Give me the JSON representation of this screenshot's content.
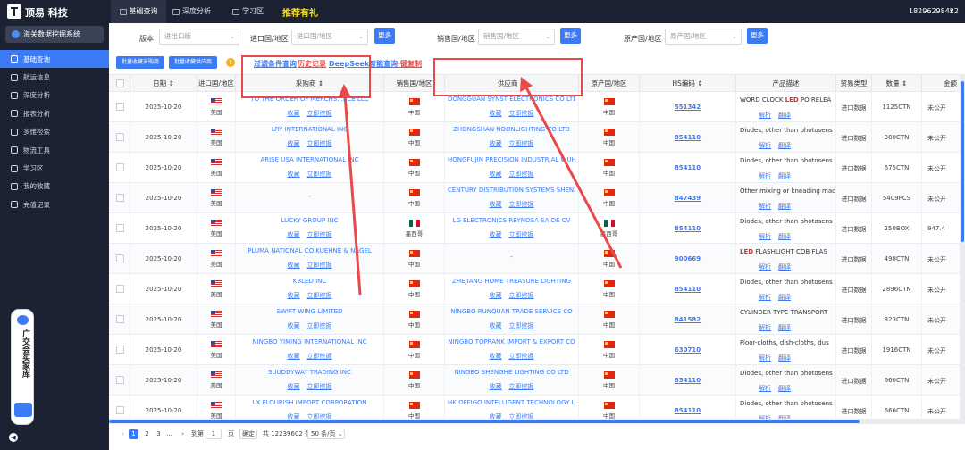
{
  "brand": "顶易 科技",
  "nav": {
    "tabs": [
      "基础查询",
      "深度分析",
      "学习区"
    ],
    "promo": "推荐有礼",
    "user_phone": "18296298422"
  },
  "sidebar": {
    "system_title": "海关数据挖掘系统",
    "items": [
      "基础查询",
      "航运信息",
      "深度分析",
      "报表分析",
      "多维检索",
      "物流工具",
      "学习区",
      "我的收藏",
      "充值记录"
    ],
    "guangjiao_label": "广交会买家库"
  },
  "filters": {
    "version_label": "版本",
    "version_placeholder": "进出口版",
    "import_label": "进口国/地区",
    "import_placeholder": "进口国/地区",
    "sales_label": "销售国/地区",
    "sales_placeholder": "销售国/地区",
    "origin_label": "原产国/地区",
    "origin_placeholder": "原产国/地区",
    "more_label": "更多"
  },
  "actions": {
    "batch_buyer": "批量收藏采购商",
    "batch_supplier": "批量收藏供应商",
    "link_filter": "过滤条件查询",
    "link_history": "历史记录",
    "link_deepseek": "DeepSeek智能查询",
    "link_copy": "一键复制"
  },
  "table": {
    "headers": [
      "",
      "日期",
      "进口国/地区",
      "采购商",
      "销售国/地区",
      "供应商",
      "原产国/地区",
      "HS编码",
      "产品描述",
      "贸易类型",
      "数量",
      "金额"
    ],
    "action_collect": "收藏",
    "action_mine": "立即挖掘",
    "action_parse": "解析",
    "action_translate": "翻译",
    "rows": [
      {
        "date": "2025-10-20",
        "imp_flag": "us",
        "imp": "美国",
        "buyer": "TO THE ORDER OF MERCHS...RCE LLC",
        "sale_flag": "cn",
        "sale": "中国",
        "supplier": "DONGGUAN SYNST ELECTRONICS CO LTD",
        "orig_flag": "cn",
        "orig": "中国",
        "hs": "551342",
        "desc_pre": "WORD CLOCK ",
        "desc_hl": "LED",
        "desc_post": " PO RELEA",
        "ttype": "进口数据",
        "qty": "1125CTN",
        "amt": "未公开"
      },
      {
        "date": "2025-10-20",
        "imp_flag": "us",
        "imp": "美国",
        "buyer": "LRY INTERNATIONAL INC",
        "sale_flag": "cn",
        "sale": "中国",
        "supplier": "ZHONGSHAN NOONLIGHTING CO LTD",
        "orig_flag": "cn",
        "orig": "中国",
        "hs": "854110",
        "desc_pre": "Diodes, other than photosens",
        "desc_hl": "",
        "desc_post": "",
        "ttype": "进口数据",
        "qty": "380CTN",
        "amt": "未公开"
      },
      {
        "date": "2025-10-20",
        "imp_flag": "us",
        "imp": "美国",
        "buyer": "ARISE USA INTERNATIONAL INC",
        "sale_flag": "cn",
        "sale": "中国",
        "supplier": "HONGFUJIN PRECISION INDUSTRIAL WUHAN",
        "orig_flag": "cn",
        "orig": "中国",
        "hs": "854110",
        "desc_pre": "Diodes, other than photosens",
        "desc_hl": "",
        "desc_post": "",
        "ttype": "进口数据",
        "qty": "675CTN",
        "amt": "未公开"
      },
      {
        "date": "2025-10-20",
        "imp_flag": "us",
        "imp": "美国",
        "buyer": "-",
        "sale_flag": "cn",
        "sale": "中国",
        "supplier": "CENTURY DISTRIBUTION SYSTEMS SHENZ",
        "orig_flag": "cn",
        "orig": "中国",
        "hs": "847439",
        "desc_pre": "Other mixing or kneading mac",
        "desc_hl": "",
        "desc_post": "",
        "ttype": "进口数据",
        "qty": "5409PCS",
        "amt": "未公开"
      },
      {
        "date": "2025-10-20",
        "imp_flag": "us",
        "imp": "美国",
        "buyer": "LUCKY GROUP INC",
        "sale_flag": "mx",
        "sale": "墨西哥",
        "supplier": "LG ELECTRONICS REYNOSA SA DE CV",
        "orig_flag": "mx",
        "orig": "墨西哥",
        "hs": "854110",
        "desc_pre": "Diodes, other than photosens",
        "desc_hl": "",
        "desc_post": "",
        "ttype": "进口数据",
        "qty": "250BOX",
        "amt": "947.4"
      },
      {
        "date": "2025-10-20",
        "imp_flag": "us",
        "imp": "美国",
        "buyer": "PLUMA NATIONAL CO KUEHNE & NAGEL",
        "sale_flag": "cn",
        "sale": "中国",
        "supplier": "-",
        "orig_flag": "cn",
        "orig": "中国",
        "hs": "900669",
        "desc_pre": "",
        "desc_hl": "LED",
        "desc_post": " FLASHLIGHT COB FLAS",
        "ttype": "进口数据",
        "qty": "498CTN",
        "amt": "未公开"
      },
      {
        "date": "2025-10-20",
        "imp_flag": "us",
        "imp": "美国",
        "buyer": "KBLED INC",
        "sale_flag": "cn",
        "sale": "中国",
        "supplier": "ZHEJIANG HOME TREASURE LIGHTING",
        "orig_flag": "cn",
        "orig": "中国",
        "hs": "854110",
        "desc_pre": "Diodes, other than photosens",
        "desc_hl": "",
        "desc_post": "",
        "ttype": "进口数据",
        "qty": "2896CTN",
        "amt": "未公开"
      },
      {
        "date": "2025-10-20",
        "imp_flag": "us",
        "imp": "美国",
        "buyer": "SWIFT WING LIMITED",
        "sale_flag": "cn",
        "sale": "中国",
        "supplier": "NINGBO RUNQUAN TRADE SERVICE CO",
        "orig_flag": "cn",
        "orig": "中国",
        "hs": "841582",
        "desc_pre": "CYLINDER TYPE TRANSPORT",
        "desc_hl": "",
        "desc_post": "",
        "ttype": "进口数据",
        "qty": "823CTN",
        "amt": "未公开"
      },
      {
        "date": "2025-10-20",
        "imp_flag": "us",
        "imp": "美国",
        "buyer": "NINGBO YIMING INTERNATIONAL INC",
        "sale_flag": "cn",
        "sale": "中国",
        "supplier": "NINGBO TOPRANK IMPORT & EXPORT CO",
        "orig_flag": "cn",
        "orig": "中国",
        "hs": "630710",
        "desc_pre": "Floor-cloths, dish-cloths, dus",
        "desc_hl": "",
        "desc_post": "",
        "ttype": "进口数据",
        "qty": "1916CTN",
        "amt": "未公开"
      },
      {
        "date": "2025-10-20",
        "imp_flag": "us",
        "imp": "美国",
        "buyer": "SUUDDYWAY TRADING INC",
        "sale_flag": "cn",
        "sale": "中国",
        "supplier": "NINGBO SHENGHE LIGHTING CO LTD",
        "orig_flag": "cn",
        "orig": "中国",
        "hs": "854110",
        "desc_pre": "Diodes, other than photosens",
        "desc_hl": "",
        "desc_post": "",
        "ttype": "进口数据",
        "qty": "660CTN",
        "amt": "未公开"
      },
      {
        "date": "2025-10-20",
        "imp_flag": "us",
        "imp": "美国",
        "buyer": "LX FLOURISH IMPORT CORPORATION",
        "sale_flag": "cn",
        "sale": "中国",
        "supplier": "HK OFFIGO INTELLIGENT TECHNOLOGY LI",
        "orig_flag": "cn",
        "orig": "中国",
        "hs": "854110",
        "desc_pre": "Diodes, other than photosens",
        "desc_hl": "",
        "desc_post": "",
        "ttype": "进口数据",
        "qty": "666CTN",
        "amt": "未公开"
      }
    ]
  },
  "pager": {
    "pages": [
      "1",
      "2",
      "3",
      "..."
    ],
    "goto_label": "到第",
    "goto_value": "1",
    "goto_unit": "页",
    "confirm": "确定",
    "total": "共 12239602 条",
    "page_size": "50 条/页"
  },
  "colors": {
    "accent": "#3b7bf6",
    "sidebar": "#1d2233",
    "highlight": "#e84a4a"
  }
}
